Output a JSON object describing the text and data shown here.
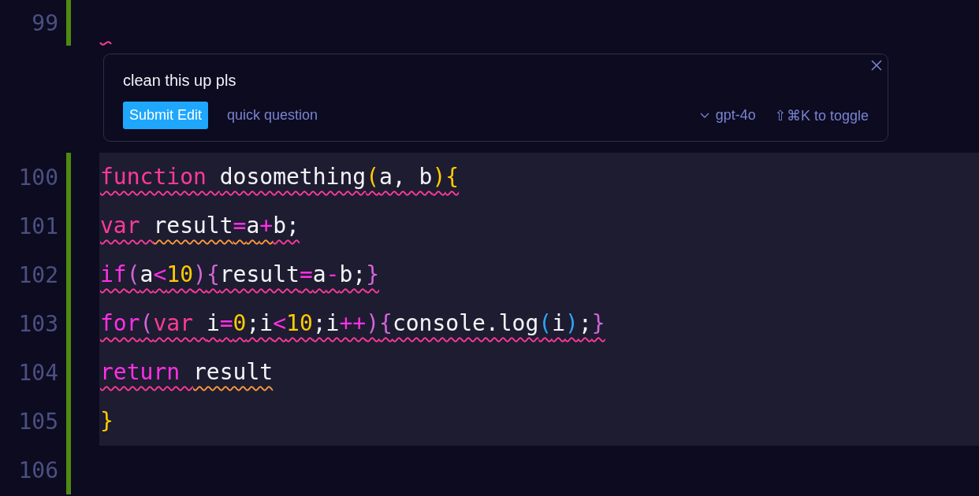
{
  "editor": {
    "lines_before": [
      {
        "number": "99",
        "error_marker": true
      }
    ],
    "edit_widget": {
      "prompt": "clean this up pls",
      "submit_button": "Submit Edit",
      "secondary_link": "quick question",
      "model": "gpt-4o",
      "shortcut_hint": "⇧⌘K to toggle"
    },
    "lines": [
      {
        "number": "100",
        "highlighted": true,
        "tokens": [
          {
            "text": "function ",
            "kind": "keyword",
            "warning": false
          },
          {
            "text": "dosomething",
            "kind": "text",
            "warning": false
          },
          {
            "text": "(",
            "kind": "bracket",
            "warning": false
          },
          {
            "text": "a, b",
            "kind": "text",
            "warning": false
          },
          {
            "text": ")",
            "kind": "bracket",
            "warning": false
          },
          {
            "text": "{",
            "kind": "bracket",
            "warning": false
          }
        ]
      },
      {
        "number": "101",
        "highlighted": true,
        "tokens": [
          {
            "text": "var ",
            "kind": "keyword",
            "warning": false
          },
          {
            "text": "result",
            "kind": "text",
            "warning": true
          },
          {
            "text": "=",
            "kind": "operator",
            "warning": true
          },
          {
            "text": "a",
            "kind": "text",
            "warning": true
          },
          {
            "text": "+",
            "kind": "operator",
            "warning": true
          },
          {
            "text": "b;",
            "kind": "text",
            "warning": false
          }
        ]
      },
      {
        "number": "102",
        "highlighted": true,
        "tokens": [
          {
            "text": "if",
            "kind": "control",
            "warning": false
          },
          {
            "text": "(",
            "kind": "paren",
            "warning": false
          },
          {
            "text": "a",
            "kind": "text",
            "warning": false
          },
          {
            "text": "<",
            "kind": "operator",
            "warning": false
          },
          {
            "text": "10",
            "kind": "number",
            "warning": false
          },
          {
            "text": ")",
            "kind": "paren",
            "warning": false
          },
          {
            "text": "{",
            "kind": "paren",
            "warning": false
          },
          {
            "text": "result",
            "kind": "text",
            "warning": false
          },
          {
            "text": "=",
            "kind": "operator",
            "warning": false
          },
          {
            "text": "a",
            "kind": "text",
            "warning": false
          },
          {
            "text": "-",
            "kind": "operator",
            "warning": false
          },
          {
            "text": "b;",
            "kind": "text",
            "warning": false
          },
          {
            "text": "}",
            "kind": "paren",
            "warning": false
          }
        ]
      },
      {
        "number": "103",
        "highlighted": true,
        "tokens": [
          {
            "text": "for",
            "kind": "control",
            "warning": false
          },
          {
            "text": "(",
            "kind": "paren",
            "warning": false
          },
          {
            "text": "var ",
            "kind": "keyword",
            "warning": false
          },
          {
            "text": "i",
            "kind": "text",
            "warning": false
          },
          {
            "text": "=",
            "kind": "operator",
            "warning": false
          },
          {
            "text": "0",
            "kind": "number",
            "warning": false
          },
          {
            "text": ";i",
            "kind": "text",
            "warning": false
          },
          {
            "text": "<",
            "kind": "operator",
            "warning": false
          },
          {
            "text": "10",
            "kind": "number",
            "warning": false
          },
          {
            "text": ";i",
            "kind": "text",
            "warning": false
          },
          {
            "text": "++",
            "kind": "operator",
            "warning": false
          },
          {
            "text": ")",
            "kind": "paren",
            "warning": false
          },
          {
            "text": "{",
            "kind": "paren",
            "warning": false
          },
          {
            "text": "console.log",
            "kind": "text",
            "warning": false
          },
          {
            "text": "(",
            "kind": "call",
            "warning": false
          },
          {
            "text": "i",
            "kind": "text",
            "warning": false
          },
          {
            "text": ")",
            "kind": "call",
            "warning": false
          },
          {
            "text": ";",
            "kind": "text",
            "warning": false
          },
          {
            "text": "}",
            "kind": "paren",
            "warning": false
          }
        ]
      },
      {
        "number": "104",
        "highlighted": true,
        "tokens": [
          {
            "text": "return ",
            "kind": "control",
            "warning": false
          },
          {
            "text": "result",
            "kind": "text",
            "warning": true
          }
        ]
      },
      {
        "number": "105",
        "highlighted": true,
        "squiggly": false,
        "tokens": [
          {
            "text": "}",
            "kind": "bracket"
          }
        ]
      },
      {
        "number": "106",
        "highlighted": false
      }
    ]
  }
}
